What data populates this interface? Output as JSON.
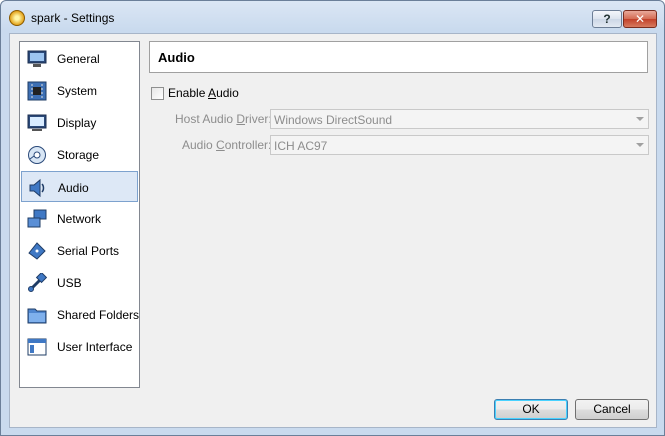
{
  "window": {
    "title": "spark - Settings",
    "help_glyph": "?",
    "close_glyph": "✕"
  },
  "sidebar": {
    "items": [
      {
        "label": "General",
        "icon": "monitor-icon"
      },
      {
        "label": "System",
        "icon": "chip-icon"
      },
      {
        "label": "Display",
        "icon": "display-icon"
      },
      {
        "label": "Storage",
        "icon": "disk-icon"
      },
      {
        "label": "Audio",
        "icon": "speaker-icon",
        "selected": true
      },
      {
        "label": "Network",
        "icon": "network-icon"
      },
      {
        "label": "Serial Ports",
        "icon": "serial-port-icon"
      },
      {
        "label": "USB",
        "icon": "usb-icon"
      },
      {
        "label": "Shared Folders",
        "icon": "folder-icon"
      },
      {
        "label": "User Interface",
        "icon": "window-icon"
      }
    ]
  },
  "page": {
    "title": "Audio",
    "enable_audio": {
      "label_pre": "Enable ",
      "label_key": "A",
      "label_post": "udio",
      "checked": false
    },
    "host_driver": {
      "label_pre": "Host Audio ",
      "label_key": "D",
      "label_post": "river:",
      "value": "Windows DirectSound"
    },
    "controller": {
      "label_pre": "Audio ",
      "label_key": "C",
      "label_post": "ontroller:",
      "value": "ICH AC97"
    }
  },
  "buttons": {
    "ok": "OK",
    "cancel": "Cancel"
  },
  "colors": {
    "selection": "#dde8f6",
    "selection_border": "#7da2ce",
    "disabled_text": "#8d8d8d"
  }
}
